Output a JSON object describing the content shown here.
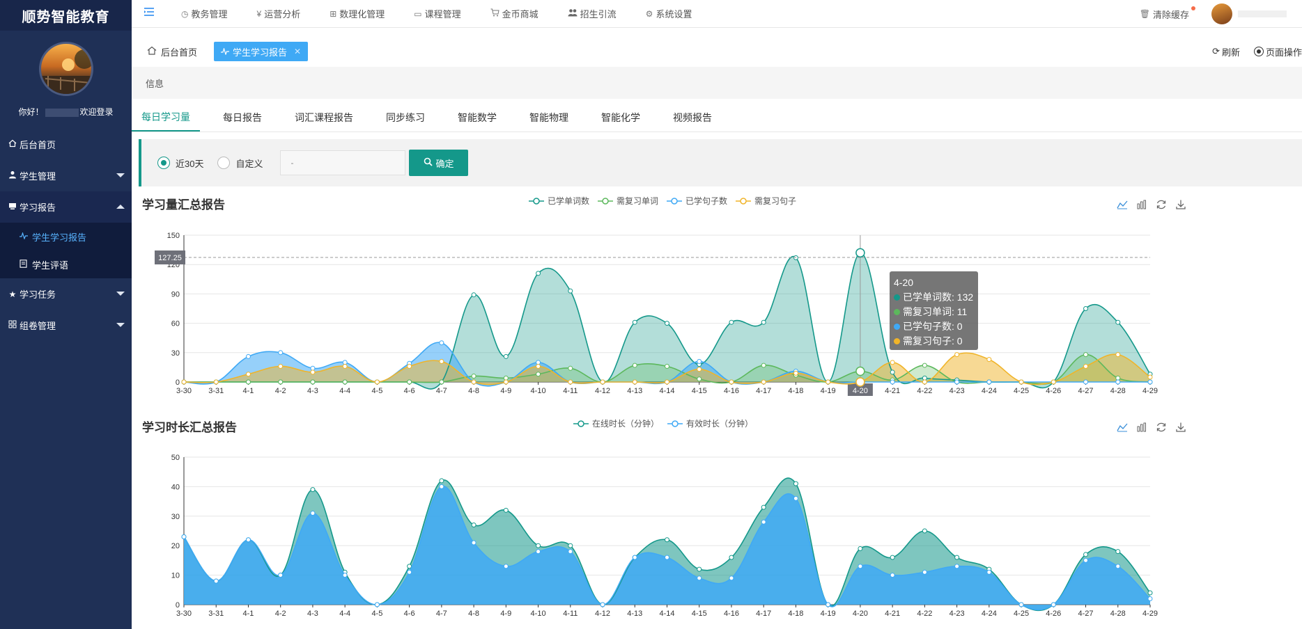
{
  "app": {
    "brand": "顺势智能教育"
  },
  "sidebar": {
    "welcome_prefix": "你好！",
    "welcome_suffix": "欢迎登录",
    "items": [
      {
        "label": "后台首页",
        "icon": "home-icon"
      },
      {
        "label": "学生管理",
        "icon": "user-icon"
      },
      {
        "label": "学习报告",
        "icon": "report-icon"
      },
      {
        "label": "学习任务",
        "icon": "star-icon"
      },
      {
        "label": "组卷管理",
        "icon": "grid-icon"
      }
    ],
    "sub_items": [
      {
        "label": "学生学习报告",
        "icon": "pulse-icon"
      },
      {
        "label": "学生评语",
        "icon": "doc-icon"
      }
    ]
  },
  "topbar": {
    "menus": [
      {
        "label": "教务管理",
        "icon": "clock-icon"
      },
      {
        "label": "运营分析",
        "icon": "yen-icon"
      },
      {
        "label": "数理化管理",
        "icon": "grid-plus-icon"
      },
      {
        "label": "课程管理",
        "icon": "book-icon"
      },
      {
        "label": "金币商城",
        "icon": "cart-icon"
      },
      {
        "label": "招生引流",
        "icon": "users-icon"
      },
      {
        "label": "系统设置",
        "icon": "gear-icon"
      }
    ],
    "clear_cache": "清除缓存"
  },
  "tabs": {
    "home": "后台首页",
    "active": "学生学习报告",
    "refresh": "刷新",
    "page_ops": "页面操作"
  },
  "info": "信息",
  "subtabs": [
    "每日学习量",
    "每日报告",
    "词汇课程报告",
    "同步练习",
    "智能数学",
    "智能物理",
    "智能化学",
    "视频报告"
  ],
  "filter": {
    "option_30": "近30天",
    "option_custom": "自定义",
    "range_value": "-",
    "confirm": "确定"
  },
  "chart_data": [
    {
      "type": "area",
      "title": "学习量汇总报告",
      "x": [
        "3-30",
        "3-31",
        "4-1",
        "4-2",
        "4-3",
        "4-4",
        "4-5",
        "4-6",
        "4-7",
        "4-8",
        "4-9",
        "4-10",
        "4-11",
        "4-12",
        "4-13",
        "4-14",
        "4-15",
        "4-16",
        "4-17",
        "4-18",
        "4-19",
        "4-20",
        "4-21",
        "4-22",
        "4-23",
        "4-24",
        "4-25",
        "4-26",
        "4-27",
        "4-28",
        "4-29"
      ],
      "ylim": [
        0,
        150
      ],
      "yticks": [
        0,
        30,
        60,
        90,
        120,
        150
      ],
      "legend_placement": "top-center",
      "series": [
        {
          "name": "已学单词数",
          "color": "#14988a",
          "values": [
            0,
            0,
            0,
            0,
            0,
            0,
            0,
            0,
            0,
            89,
            26,
            111,
            93,
            0,
            61,
            60,
            18,
            61,
            61,
            127,
            0,
            132,
            10,
            4,
            2,
            0,
            0,
            0,
            75,
            61,
            8
          ]
        },
        {
          "name": "需复习单词",
          "color": "#5cb85c",
          "values": [
            0,
            0,
            0,
            0,
            0,
            0,
            0,
            0,
            0,
            6,
            4,
            8,
            14,
            0,
            17,
            16,
            3,
            0,
            17,
            7,
            0,
            11,
            2,
            17,
            0,
            0,
            0,
            0,
            28,
            4,
            0
          ]
        },
        {
          "name": "已学句子数",
          "color": "#3fa9f5",
          "values": [
            0,
            0,
            26,
            30,
            14,
            20,
            0,
            19,
            40,
            0,
            0,
            20,
            0,
            0,
            0,
            0,
            21,
            0,
            0,
            11,
            0,
            0,
            0,
            0,
            0,
            0,
            0,
            0,
            0,
            0,
            0
          ]
        },
        {
          "name": "需复习句子",
          "color": "#f0b429",
          "values": [
            0,
            0,
            8,
            16,
            10,
            16,
            0,
            16,
            21,
            0,
            0,
            16,
            0,
            0,
            0,
            0,
            13,
            0,
            0,
            9,
            0,
            0,
            20,
            0,
            28,
            23,
            0,
            0,
            16,
            28,
            5
          ]
        }
      ],
      "axis_pointer": {
        "value": "127.25",
        "category": "4-20"
      },
      "tooltip": {
        "title": "4-20",
        "lines": [
          {
            "text": "已学单词数: 132",
            "color": "#14988a"
          },
          {
            "text": "需复习单词: 11",
            "color": "#5cb85c"
          },
          {
            "text": "已学句子数: 0",
            "color": "#3fa9f5"
          },
          {
            "text": "需复习句子: 0",
            "color": "#f0b429"
          }
        ]
      }
    },
    {
      "type": "area",
      "title": "学习时长汇总报告",
      "x": [
        "3-30",
        "3-31",
        "4-1",
        "4-2",
        "4-3",
        "4-4",
        "4-5",
        "4-6",
        "4-7",
        "4-8",
        "4-9",
        "4-10",
        "4-11",
        "4-12",
        "4-13",
        "4-14",
        "4-15",
        "4-16",
        "4-17",
        "4-18",
        "4-19",
        "4-20",
        "4-21",
        "4-22",
        "4-23",
        "4-24",
        "4-25",
        "4-26",
        "4-27",
        "4-28",
        "4-29"
      ],
      "ylim": [
        0,
        50
      ],
      "yticks": [
        0,
        10,
        20,
        30,
        40,
        50
      ],
      "legend_placement": "top-center",
      "series": [
        {
          "name": "在线时长（分钟）",
          "color": "#14988a",
          "values": [
            23,
            8,
            22,
            10,
            39,
            11,
            0,
            13,
            42,
            27,
            32,
            20,
            20,
            0,
            16,
            22,
            12,
            16,
            33,
            41,
            0,
            19,
            16,
            25,
            16,
            12,
            0,
            0,
            17,
            18,
            4
          ]
        },
        {
          "name": "有效时长（分钟）",
          "color": "#3fa9f5",
          "values": [
            23,
            8,
            22,
            10,
            31,
            10,
            0,
            11,
            40,
            21,
            13,
            18,
            18,
            0,
            16,
            16,
            9,
            9,
            28,
            36,
            0,
            13,
            10,
            11,
            13,
            11,
            0,
            0,
            15,
            13,
            2
          ]
        }
      ]
    }
  ]
}
